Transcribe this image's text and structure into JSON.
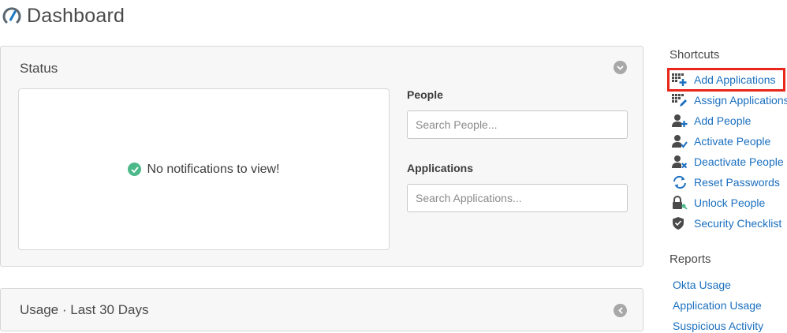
{
  "header": {
    "title": "Dashboard",
    "logo_icon": "okta-gauge-icon"
  },
  "status_panel": {
    "title": "Status",
    "collapse_icon": "chevron-down-icon",
    "notifications": {
      "message": "No notifications to view!",
      "icon": "check-circle-icon"
    },
    "people": {
      "label": "People",
      "placeholder": "Search People..."
    },
    "applications": {
      "label": "Applications",
      "placeholder": "Search Applications..."
    }
  },
  "usage_panel": {
    "title": "Usage · Last 30 Days",
    "expand_icon": "chevron-left-icon"
  },
  "shortcuts": {
    "heading": "Shortcuts",
    "items": [
      {
        "label": "Add Applications",
        "icon": "grid-plus-icon",
        "highlighted": true
      },
      {
        "label": "Assign Applications",
        "icon": "grid-pencil-icon"
      },
      {
        "label": "Add People",
        "icon": "person-plus-icon"
      },
      {
        "label": "Activate People",
        "icon": "person-check-icon"
      },
      {
        "label": "Deactivate People",
        "icon": "person-x-icon"
      },
      {
        "label": "Reset Passwords",
        "icon": "refresh-icon"
      },
      {
        "label": "Unlock People",
        "icon": "unlock-icon"
      },
      {
        "label": "Security Checklist",
        "icon": "shield-check-icon"
      }
    ]
  },
  "reports": {
    "heading": "Reports",
    "items": [
      {
        "label": "Okta Usage"
      },
      {
        "label": "Application Usage"
      },
      {
        "label": "Suspicious Activity"
      }
    ]
  },
  "colors": {
    "link": "#1a6fbf",
    "highlight": "#e8261c",
    "success": "#4cb98a",
    "panel_bg": "#f7f7f7"
  }
}
